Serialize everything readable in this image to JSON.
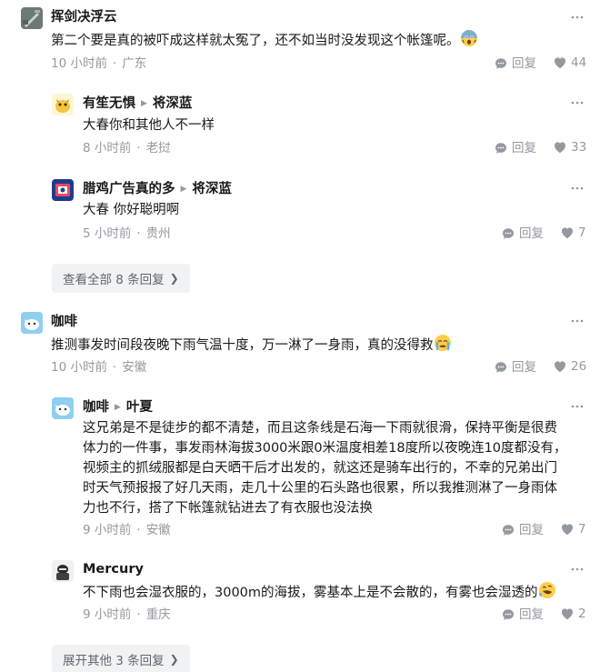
{
  "comments": [
    {
      "author": "挥剑决浮云",
      "text": "第二个要是真的被吓成这样就太冤了，还不如当时没发现这个帐篷呢。",
      "time": "10 小时前",
      "location": "广东",
      "reply_label": "回复",
      "likes": "44",
      "replies": [
        {
          "author": "有笙无惧",
          "reply_to": "将深蓝",
          "text": "大春你和其他人不一样",
          "time": "8 小时前",
          "location": "老挝",
          "reply_label": "回复",
          "likes": "33"
        },
        {
          "author": "腊鸡广告真的多",
          "reply_to": "将深蓝",
          "text": "大春 你好聪明啊",
          "time": "5 小时前",
          "location": "贵州",
          "reply_label": "回复",
          "likes": "7"
        }
      ],
      "view_all": "查看全部 8 条回复"
    },
    {
      "author": "咖啡",
      "text": "推测事发时间段夜晚下雨气温十度，万一淋了一身雨，真的没得救",
      "time": "10 小时前",
      "location": "安徽",
      "reply_label": "回复",
      "likes": "26",
      "replies": [
        {
          "author": "咖啡",
          "reply_to": "叶夏",
          "text_lines": [
            "这兄弟是不是徒步的都不清楚，而且这条线是石海一下雨就很滑，保持平衡是很费",
            "体力的一件事，事发雨林海拔3000米跟0米温度相差18度所以夜晚连10度都没有，",
            "视频主的抓绒服都是白天晒干后才出发的，就这还是骑车出行的，不幸的兄弟出门",
            "时天气预报报了好几天雨，走几十公里的石头路也很累，所以我推测淋了一身雨体",
            "力也不行，搭了下帐篷就钻进去了有衣服也没法换"
          ],
          "time": "9 小时前",
          "location": "安徽",
          "reply_label": "回复",
          "likes": "7"
        },
        {
          "author": "Mercury",
          "text": "不下雨也会湿衣服的，3000m的海拔，雾基本上是不会散的，有雾也会湿透的",
          "time": "9 小时前",
          "location": "重庆",
          "reply_label": "回复",
          "likes": "2"
        }
      ],
      "view_all": "展开其他 3 条回复"
    }
  ],
  "colors": {
    "text": "#18191c",
    "meta": "#9499a0",
    "button_bg": "#f1f2f3"
  },
  "icons": [
    "more-icon",
    "reply-icon",
    "like-icon",
    "scared-emoji",
    "crying-emoji",
    "laughing-emoji",
    "chevron-right-icon"
  ]
}
